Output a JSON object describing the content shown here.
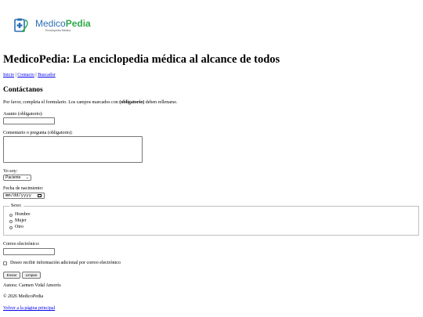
{
  "logo": {
    "name_part1": "Medico",
    "name_part2": "Pedia",
    "tagline": "Enciclopedia Médica",
    "icon": "medical-clipboard-stethoscope-icon",
    "colors": {
      "blue": "#2b6fb3",
      "green": "#2eaa4a"
    }
  },
  "page_title": "MedicoPedia: La enciclopedia médica al alcance de todos",
  "nav": {
    "inicio": "Inicio",
    "contacto": "Contacto",
    "buscador": "Buscador",
    "separator": "|"
  },
  "section_title": "Contáctanos",
  "intro": {
    "before": "Por favor, completa el formulario. Los campos marcados con ",
    "bold": "(obligatorio)",
    "after": " deben rellenarse."
  },
  "form": {
    "asunto_label": "Asunto (obligatorio):",
    "asunto_value": "",
    "comentario_label": "Comentario o pregunta (obligatorio):",
    "comentario_value": "",
    "yo_soy_label": "Yo soy:",
    "yo_soy_selected": "Paciente",
    "fecha_label": "Fecha de nacimiento:",
    "fecha_placeholder": "mm/dd/yyyy",
    "sexo_legend": "Sexo:",
    "sexo_options": [
      "Hombre",
      "Mujer",
      "Otro"
    ],
    "correo_label": "Correo electrónico:",
    "correo_value": "",
    "newsletter_label": "Deseo recibir información adicional por correo electrónico",
    "enviar": "Enviar",
    "limpiar": "Limpiar"
  },
  "footer": {
    "autora": "Autora: Carmen Vidal Amorós",
    "copyright": "© 2026 MedicoPedia",
    "volver": "Volver a la página principal"
  }
}
